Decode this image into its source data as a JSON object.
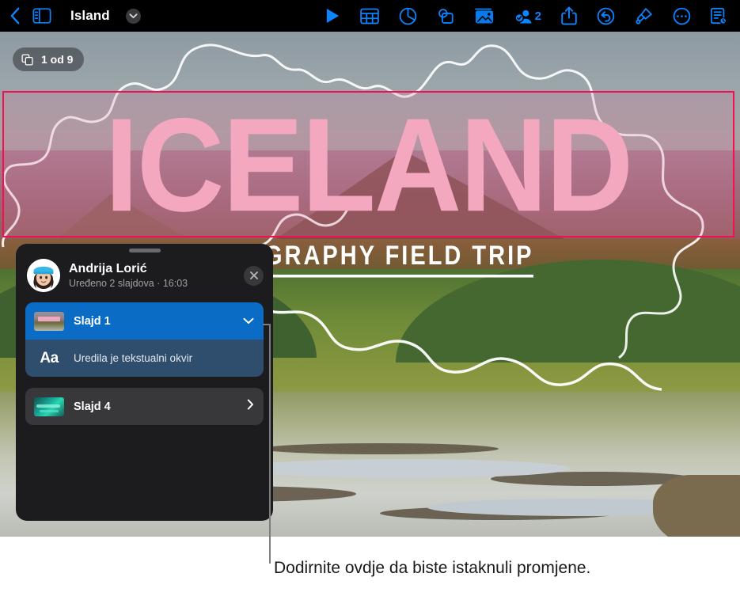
{
  "toolbar": {
    "back_icon": "chevron-left-icon",
    "sidebar_icon": "sidebar-toggle-icon",
    "title": "Island",
    "title_chevron_icon": "chevron-down-icon",
    "actions": [
      {
        "name": "play-button",
        "icon": "play-icon",
        "label": "Reproduciraj"
      },
      {
        "name": "table-button",
        "icon": "table-icon",
        "label": "Tablica"
      },
      {
        "name": "chart-button",
        "icon": "chart-icon",
        "label": "Grafikon"
      },
      {
        "name": "shape-button",
        "icon": "shape-icon",
        "label": "Oblik"
      },
      {
        "name": "media-button",
        "icon": "media-icon",
        "label": "Medij"
      },
      {
        "name": "collaborate-button",
        "icon": "collaborate-icon",
        "label": "Suradnja"
      },
      {
        "name": "share-button",
        "icon": "share-icon",
        "label": "Dijeli"
      },
      {
        "name": "undo-button",
        "icon": "undo-icon",
        "label": "Poništi"
      },
      {
        "name": "format-button",
        "icon": "paintbrush-icon",
        "label": "Format"
      },
      {
        "name": "more-button",
        "icon": "ellipsis-icon",
        "label": "Više"
      },
      {
        "name": "document-activity-button",
        "icon": "document-clock-icon",
        "label": "Aktivnost dokumenta"
      }
    ],
    "collaborators_count": "2"
  },
  "slide_badge": {
    "icon": "slides-icon",
    "label": "1 od 9"
  },
  "slide": {
    "title": "ICELAND",
    "subtitle": "GEOGRAPHY FIELD TRIP",
    "selection_border_color": "#f2114f",
    "title_color": "#f4a8c0"
  },
  "activity_panel": {
    "grabber": "drag-handle",
    "avatar": "user-avatar",
    "person_name": "Andrija Lorić",
    "person_subtitle": "Uređeno 2 slajdova · 16:03",
    "close_icon": "close-icon",
    "entries": [
      {
        "name": "activity-slide-1",
        "thumbnail": "slide-1-thumbnail",
        "label": "Slajd 1",
        "chevron": "chevron-down-icon",
        "selected": true,
        "detail": {
          "icon": "text-format-icon",
          "icon_glyph": "Aa",
          "label": "Uredila je tekstualni okvir"
        }
      },
      {
        "name": "activity-slide-4",
        "thumbnail": "slide-4-thumbnail",
        "label": "Slajd 4",
        "chevron": "chevron-right-icon",
        "selected": false
      }
    ]
  },
  "callout": {
    "caption": "Dodirnite ovdje da biste istaknuli promjene.",
    "line_color": "#7d7d7d"
  },
  "colors": {
    "accent_blue": "#0a84ff",
    "panel_background": "#1c1c1e",
    "selected_row": "#0a6cc4",
    "sub_row": "#2f4e6d",
    "toolbar_background": "#000000"
  }
}
